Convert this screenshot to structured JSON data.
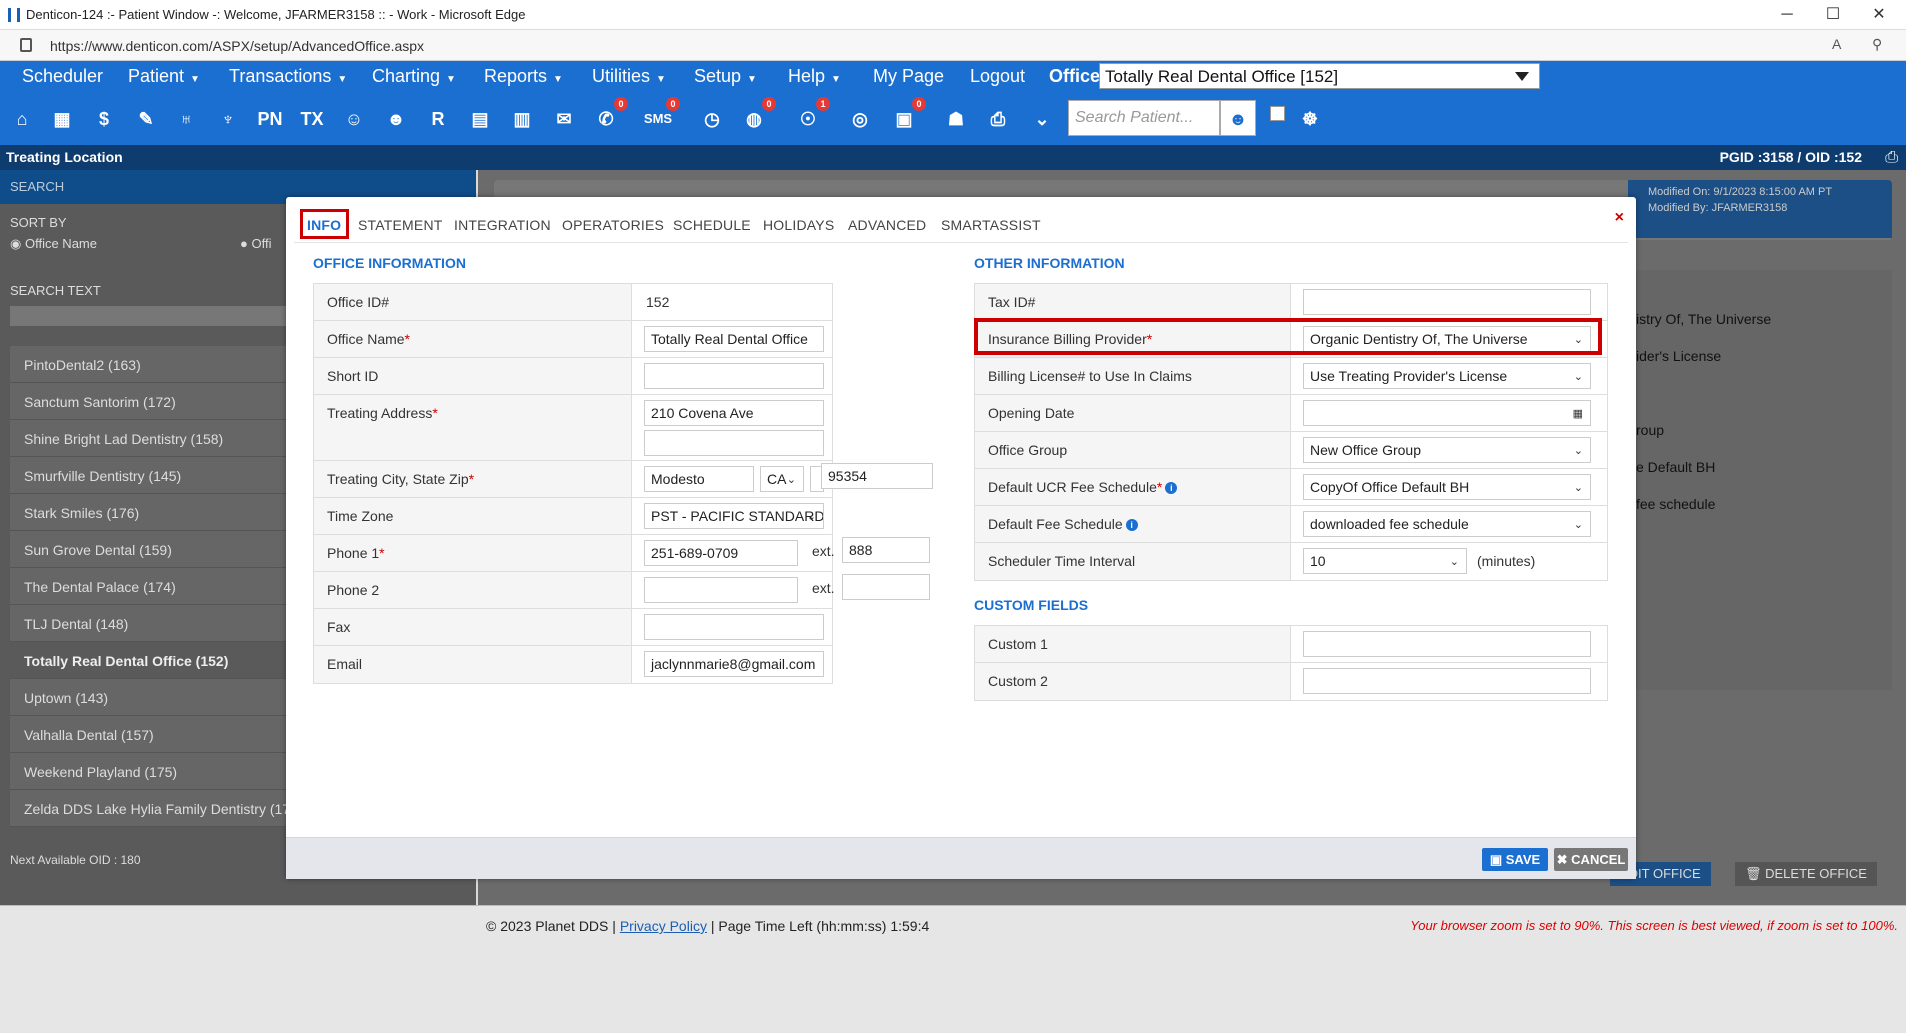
{
  "window": {
    "title": "Denticon-124 :- Patient Window -: Welcome, JFARMER3158 :: - Work - Microsoft Edge",
    "url": "https://www.denticon.com/ASPX/setup/AdvancedOffice.aspx",
    "min": "─",
    "max": "☐",
    "close": "✕"
  },
  "menu": {
    "items": [
      "Scheduler",
      "Patient",
      "Transactions",
      "Charting",
      "Reports",
      "Utilities",
      "Setup",
      "Help",
      "My Page",
      "Logout"
    ],
    "office_label": "Office",
    "office_value": "Totally Real Dental Office [152]"
  },
  "toolbar": {
    "search_placeholder": "Search Patient...",
    "badges": {
      "messages": "0",
      "sms": "0",
      "globe": "0",
      "alerts": "1",
      "tasks": "0"
    },
    "icon_labels": {
      "pn": "PN",
      "tx": "TX",
      "rx": "R",
      "sms": "SMS"
    }
  },
  "location_bar": {
    "title": "Treating Location",
    "ids": "PGID :3158  /  OID :152"
  },
  "left_panel": {
    "search_header": "SEARCH",
    "sort_by": "SORT BY",
    "sort_option": "Office Name",
    "sort_option2": "Offi",
    "search_text": "SEARCH TEXT",
    "offices": [
      "PintoDental2 (163)",
      "Sanctum Santorim (172)",
      "Shine Bright Lad Dentistry (158)",
      "Smurfville Dentistry (145)",
      "Stark Smiles (176)",
      "Sun Grove Dental (159)",
      "The Dental Palace (174)",
      "TLJ Dental (148)",
      "Totally Real Dental Office (152)",
      "Uptown (143)",
      "Valhalla Dental (157)",
      "Weekend Playland (175)",
      "Zelda DDS Lake Hylia Family Dentistry (17"
    ],
    "next_oid": "Next Available OID : 180"
  },
  "background": {
    "modified_on": "Modified On: 9/1/2023 8:15:00 AM PT",
    "modified_by": "Modified By: JFARMER3158",
    "ghost": [
      "istry Of, The Universe",
      "ider's License",
      "roup",
      "e Default BH",
      "fee schedule"
    ],
    "edit_office": "EDIT OFFICE",
    "delete_office": "DELETE OFFICE"
  },
  "modal": {
    "tabs": [
      "INFO",
      "STATEMENT",
      "INTEGRATION",
      "OPERATORIES",
      "SCHEDULE",
      "HOLIDAYS",
      "ADVANCED",
      "SMARTASSIST"
    ],
    "close": "×",
    "office_info": {
      "header": "OFFICE INFORMATION",
      "office_id_label": "Office ID#",
      "office_id": "152",
      "office_name_label": "Office Name",
      "office_name": "Totally Real Dental Office",
      "short_id_label": "Short ID",
      "short_id": "",
      "address_label": "Treating Address",
      "address1": "210 Covena Ave",
      "address2": "",
      "city_label": "Treating City, State Zip",
      "city": "Modesto",
      "state": "CA",
      "zip": "95354",
      "timezone_label": "Time Zone",
      "timezone": "PST - PACIFIC STANDARD TIME",
      "phone1_label": "Phone 1",
      "phone1": "251-689-0709",
      "phone1_ext": "888",
      "ext_label": "ext.",
      "phone2_label": "Phone 2",
      "phone2": "",
      "phone2_ext": "",
      "fax_label": "Fax",
      "fax": "",
      "email_label": "Email",
      "email": "jaclynnmarie8@gmail.com",
      "required": "*"
    },
    "other_info": {
      "header": "OTHER INFORMATION",
      "tax_label": "Tax ID#",
      "tax": "",
      "ins_label": "Insurance Billing Provider",
      "ins": "Organic Dentistry Of, The Universe",
      "license_label": "Billing License# to Use In Claims",
      "license": "Use Treating Provider's License",
      "opening_label": "Opening Date",
      "opening": "",
      "group_label": "Office Group",
      "group": "New Office Group",
      "ucr_label": "Default UCR Fee Schedule",
      "ucr": "CopyOf Office Default BH",
      "fee_label": "Default Fee Schedule",
      "fee": "downloaded fee schedule",
      "interval_label": "Scheduler Time Interval",
      "interval": "10",
      "interval_unit": "(minutes)"
    },
    "custom": {
      "header": "CUSTOM FIELDS",
      "c1_label": "Custom 1",
      "c1": "",
      "c2_label": "Custom 2",
      "c2": ""
    },
    "save": "SAVE",
    "cancel": "CANCEL"
  },
  "footer": {
    "copyright": "© 2023 Planet DDS |",
    "privacy": "Privacy Policy",
    "time_left": "| Page Time Left (hh:mm:ss) 1:59:4",
    "zoom_msg": "Your browser zoom is set to 90%. This screen is best viewed, if zoom is set to 100%."
  },
  "colors": {
    "brand": "#1b6fd1",
    "dark": "#0f3c6e",
    "highlight": "#cc0000"
  }
}
